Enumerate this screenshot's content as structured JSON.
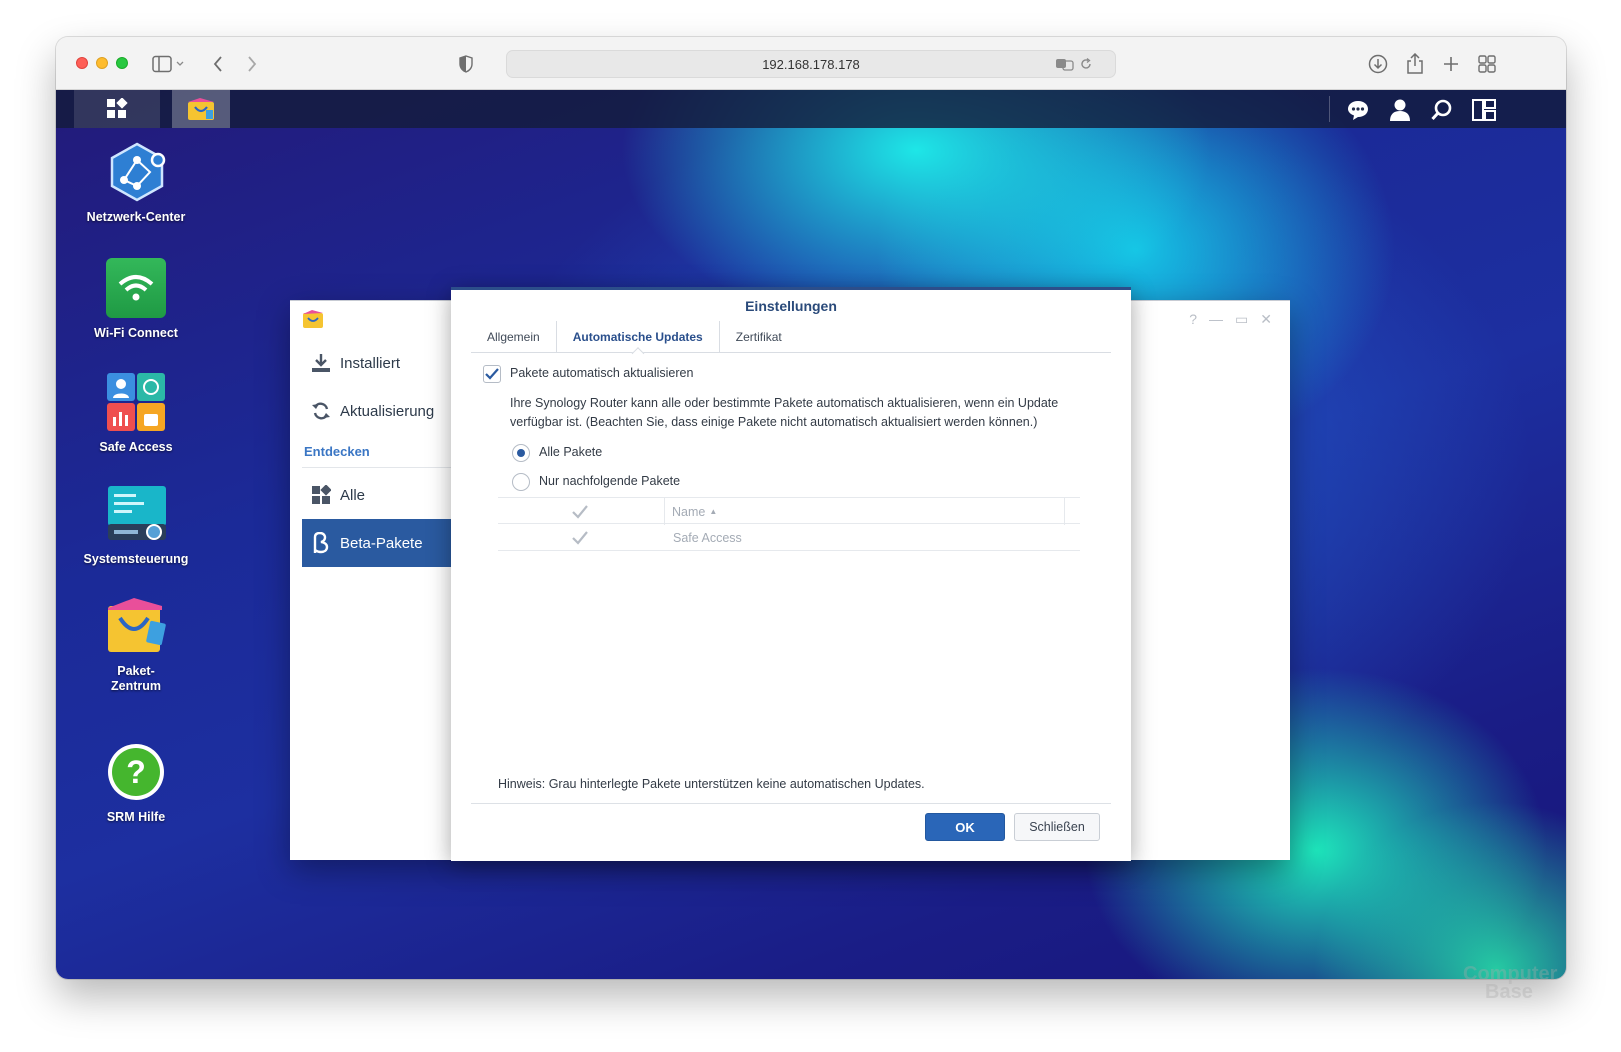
{
  "browser": {
    "url": "192.168.178.178"
  },
  "desktop": {
    "icons": [
      {
        "label": "Netzwerk-Center"
      },
      {
        "label": "Wi-Fi Connect"
      },
      {
        "label": "Safe Access"
      },
      {
        "label": "Systemsteuerung"
      },
      {
        "label": "Paket-\nZentrum"
      },
      {
        "label": "SRM Hilfe"
      }
    ]
  },
  "package_center": {
    "sidebar": {
      "installed": "Installiert",
      "update": "Aktualisierung",
      "section_discover": "Entdecken",
      "all": "Alle",
      "beta": "Beta-Pakete"
    }
  },
  "dialog": {
    "title": "Einstellungen",
    "tabs": [
      "Allgemein",
      "Automatische Updates",
      "Zertifikat"
    ],
    "auto_update_label": "Pakete automatisch aktualisieren",
    "description_line1": "Ihre Synology Router kann alle oder bestimmte Pakete automatisch aktualisieren, wenn ein Update",
    "description_line2": "verfügbar ist. (Beachten Sie, dass einige Pakete nicht automatisch aktualisiert werden können.)",
    "option_all": "Alle Pakete",
    "option_selected": "Nur nachfolgende Pakete",
    "table": {
      "column_name": "Name",
      "rows": [
        {
          "name": "Safe Access"
        }
      ]
    },
    "hint": "Hinweis: Grau hinterlegte Pakete unterstützen keine automatischen Updates.",
    "ok_label": "OK",
    "close_label": "Schließen"
  },
  "watermark": {
    "line1": "Computer",
    "line2": "Base"
  },
  "colors": {
    "accent": "#2a5aa0",
    "title": "#2a4a7a"
  }
}
